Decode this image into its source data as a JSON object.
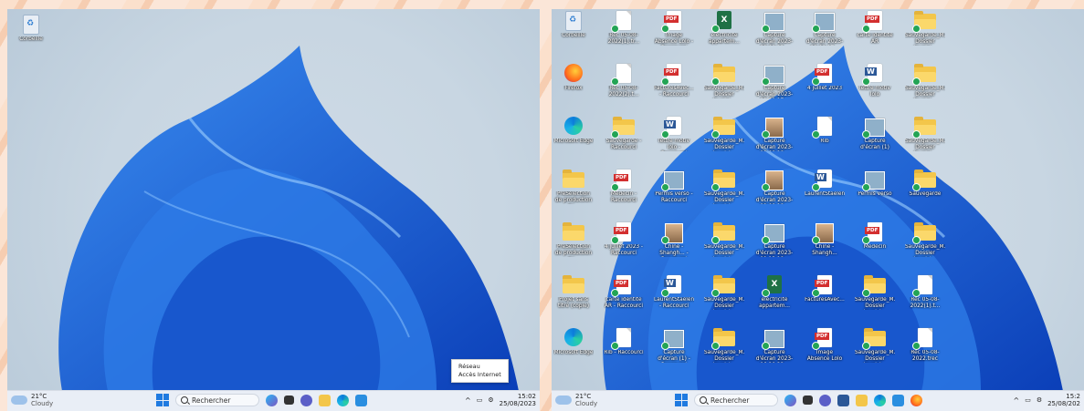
{
  "left_screen": {
    "desktop_icons": [
      {
        "label": "Corbeille",
        "icon": "recycle-bin-icon"
      }
    ],
    "tooltip": {
      "line1": "Réseau",
      "line2": "Accès Internet"
    },
    "taskbar": {
      "weather_temp": "21°C",
      "weather_desc": "Cloudy",
      "search_placeholder": "Rechercher",
      "time": "15:02",
      "date": "25/08/2023"
    }
  },
  "right_screen": {
    "desktop_icons": [
      {
        "label": "Corbeille",
        "icon": "recycle-bin-icon"
      },
      {
        "label": "Rec 05-08-2022(1).tr...",
        "icon": "document-icon"
      },
      {
        "label": "Image Absence Lolo - Raccourci",
        "icon": "pdf-icon"
      },
      {
        "label": "electricité appartem...",
        "icon": "excel-icon"
      },
      {
        "label": "Capture d'écran 2023-08-09 22...",
        "icon": "image-icon"
      },
      {
        "label": "Capture d'écran 2023-08-09 17...",
        "icon": "image-icon"
      },
      {
        "label": "carte identite AR",
        "icon": "pdf-icon"
      },
      {
        "label": "Sauvegarde_M... Dossier Invoici...",
        "icon": "folder-icon"
      },
      {
        "label": "Firefox",
        "icon": "firefox-icon"
      },
      {
        "label": "Rec 05-08-2022(2).t...",
        "icon": "document-icon"
      },
      {
        "label": "FacturesAvec... - Raccourci",
        "icon": "pdf-icon"
      },
      {
        "label": "Sauvegarde_M... Dossier Invoici...",
        "icon": "folder-icon"
      },
      {
        "label": "Capture d'écran 2023-08-09 17...",
        "icon": "image-icon"
      },
      {
        "label": "4 juillet 2023",
        "icon": "pdf-icon"
      },
      {
        "label": "lettre motiv lolo",
        "icon": "word-icon"
      },
      {
        "label": "Sauvegarde_M... Dossier Invoici...",
        "icon": "folder-icon"
      },
      {
        "label": "Microsoft Edge",
        "icon": "edge-icon"
      },
      {
        "label": "Sauvegarde - Raccourci",
        "icon": "folder-icon"
      },
      {
        "label": "lettre motiv lolo - Raccourci",
        "icon": "word-icon"
      },
      {
        "label": "Sauvegarde_M... Dossier Invoici...",
        "icon": "folder-icon"
      },
      {
        "label": "Capture d'écran 2023-08-09 18...",
        "icon": "photo-icon"
      },
      {
        "label": "Rib",
        "icon": "document-icon"
      },
      {
        "label": "Capture d'écran (1)",
        "icon": "image-icon"
      },
      {
        "label": "Sauvegarde_M... Dossier Invoici...",
        "icon": "folder-icon"
      },
      {
        "label": "PréSélection de production gu...",
        "icon": "folder-icon"
      },
      {
        "label": "Medecin - Raccourci",
        "icon": "pdf-icon"
      },
      {
        "label": "Permis verso - Raccourci",
        "icon": "image-icon"
      },
      {
        "label": "Sauvegarde_M... Dossier Invoici...",
        "icon": "folder-icon"
      },
      {
        "label": "Capture d'écran 2023-08-09 18...",
        "icon": "photo-icon"
      },
      {
        "label": "LaurentStaelen...",
        "icon": "word-icon"
      },
      {
        "label": "Permis verso",
        "icon": "image-icon"
      },
      {
        "label": "Sauvegarde",
        "icon": "folder-icon"
      },
      {
        "label": "PréSélection de production gu...",
        "icon": "folder-icon"
      },
      {
        "label": "4 juillet 2023 - Raccourci",
        "icon": "pdf-icon"
      },
      {
        "label": "Chine - Shangh... - Raccourci",
        "icon": "photo-icon"
      },
      {
        "label": "Sauvegarde_M... Dossier Invoici...",
        "icon": "folder-icon"
      },
      {
        "label": "Capture d'écran 2023-08-13 18...",
        "icon": "image-icon"
      },
      {
        "label": "Chine - Shangh...",
        "icon": "photo-icon"
      },
      {
        "label": "Medecin",
        "icon": "pdf-icon"
      },
      {
        "label": "Sauvegarde_M... Dossier Invoici...",
        "icon": "folder-icon"
      },
      {
        "label": "Projet sans titre (copie)",
        "icon": "folder-icon"
      },
      {
        "label": "carte identite AR - Raccourci",
        "icon": "pdf-icon"
      },
      {
        "label": "LaurentStaelen... - Raccourci",
        "icon": "word-icon"
      },
      {
        "label": "Sauvegarde_M... Dossier Invoici...",
        "icon": "folder-icon"
      },
      {
        "label": "electricité appartem...",
        "icon": "excel-icon"
      },
      {
        "label": "FacturesAvec...",
        "icon": "pdf-icon"
      },
      {
        "label": "Sauvegarde_M... Dossier Invoici...",
        "icon": "folder-icon"
      },
      {
        "label": "Rec 05-08-2022(1).t...",
        "icon": "document-icon"
      },
      {
        "label": "Microsoft Edge",
        "icon": "edge-icon"
      },
      {
        "label": "Rib - Raccourci",
        "icon": "document-icon"
      },
      {
        "label": "Capture d'écran (1) - Raccourci",
        "icon": "image-icon"
      },
      {
        "label": "Sauvegarde_M... Dossier Invoici...",
        "icon": "folder-icon"
      },
      {
        "label": "Capture d'écran 2023-06-28 22...",
        "icon": "image-icon"
      },
      {
        "label": "Image Absence Lolo",
        "icon": "pdf-icon"
      },
      {
        "label": "Sauvegarde_M... Dossier Invoici...",
        "icon": "folder-icon"
      },
      {
        "label": "Rec 05-08-2022.trec",
        "icon": "document-icon"
      }
    ],
    "taskbar": {
      "weather_temp": "21°C",
      "weather_desc": "Cloudy",
      "search_placeholder": "Rechercher",
      "time": "15:2",
      "date": "25/08/202"
    }
  },
  "colors": {
    "accent": "#1f7ae0",
    "wallpaper": "#c8d6e2",
    "taskbar": "#e9eef6"
  }
}
